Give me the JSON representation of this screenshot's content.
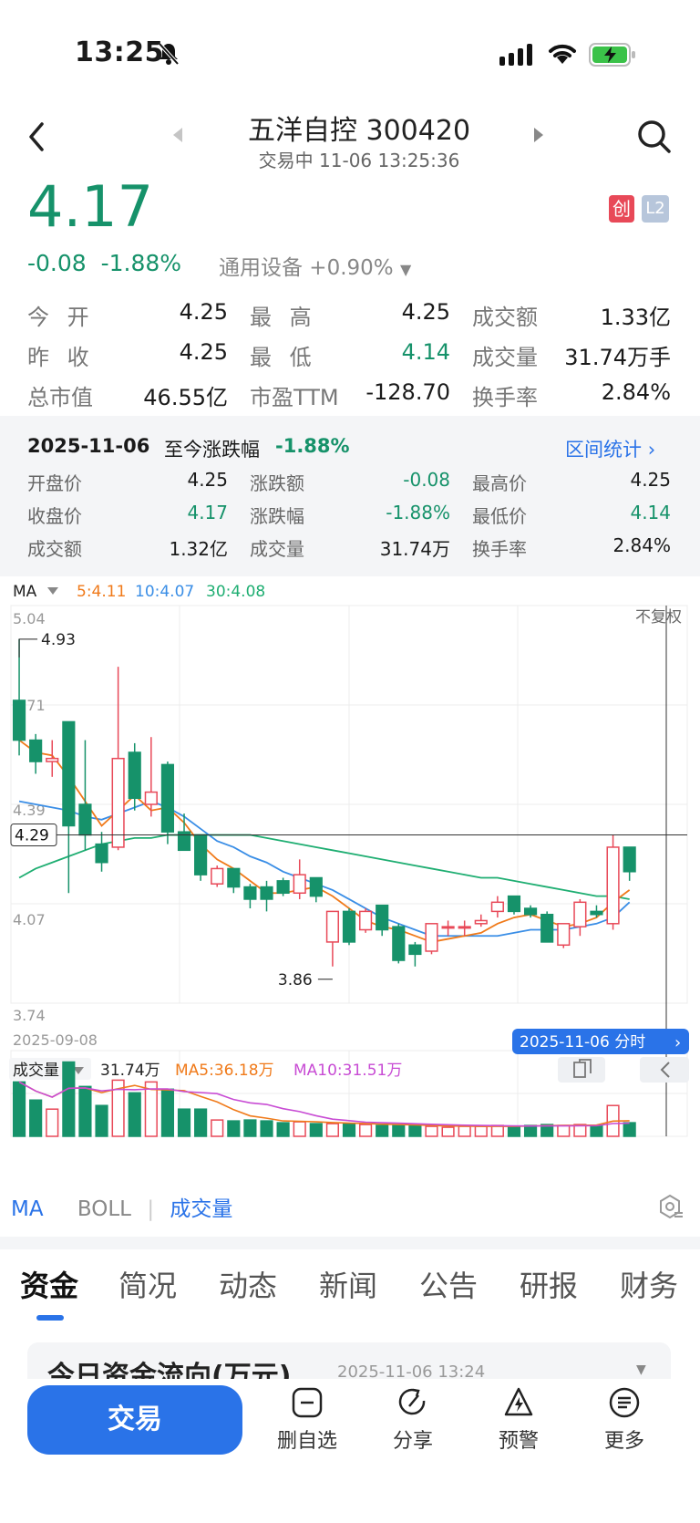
{
  "status": {
    "time": "13:25"
  },
  "header": {
    "title": "五洋自控 300420",
    "subtitle": "交易中 11-06 13:25:36"
  },
  "quote": {
    "price": "4.17",
    "change": "-0.08",
    "change_pct": "-1.88%",
    "sector": "通用设备 +0.90%",
    "badge_chuang": "创",
    "badge_l2": "L2",
    "color_down": "#16926a",
    "color_up": "#e84958"
  },
  "stats": [
    [
      {
        "label": "今 开",
        "value": "4.25"
      },
      {
        "label": "最 高",
        "value": "4.25"
      },
      {
        "label": "成交额",
        "value": "1.33亿"
      }
    ],
    [
      {
        "label": "昨 收",
        "value": "4.25"
      },
      {
        "label": "最 低",
        "value": "4.14"
      },
      {
        "label": "成交量",
        "value": "31.74万手"
      }
    ],
    [
      {
        "label": "总市值",
        "value": "46.55亿"
      },
      {
        "label": "市盈TTM",
        "value": "-128.70"
      },
      {
        "label": "换手率",
        "value": "2.84%"
      }
    ]
  ],
  "history": {
    "date": "2025-11-06",
    "range_label": "至今涨跌幅",
    "range_pct": "-1.88%",
    "link": "区间统计",
    "rows": [
      [
        {
          "label": "开盘价",
          "value": "4.25"
        },
        {
          "label": "涨跌额",
          "value": "-0.08"
        },
        {
          "label": "最高价",
          "value": "4.25"
        }
      ],
      [
        {
          "label": "收盘价",
          "value": "4.17"
        },
        {
          "label": "涨跌幅",
          "value": "-1.88%"
        },
        {
          "label": "最低价",
          "value": "4.14"
        }
      ],
      [
        {
          "label": "成交额",
          "value": "1.32亿"
        },
        {
          "label": "成交量",
          "value": "31.74万"
        },
        {
          "label": "换手率",
          "value": "2.84%"
        }
      ]
    ]
  },
  "kline": {
    "ma_selector": "MA",
    "ma5": "5:4.11",
    "ma10": "10:4.07",
    "ma30": "30:4.08",
    "adjust": "不复权",
    "y_ticks": [
      "5.04",
      "4.71",
      "4.39",
      "4.07",
      "3.74"
    ],
    "high_mark": "4.93",
    "low_mark": "3.86",
    "cross_price": "4.29",
    "start_date": "2025-09-08",
    "cross_date": "2025-11-06 分时",
    "ma_colors": {
      "ma5": "#f07a1a",
      "ma10": "#3a8ee6",
      "ma30": "#1fae72"
    }
  },
  "volume": {
    "selector": "成交量",
    "current": "31.74万",
    "ma5": "MA5:36.18万",
    "ma10": "MA10:31.51万"
  },
  "indicators": {
    "ma": "MA",
    "boll": "BOLL",
    "sep": "|",
    "vol": "成交量"
  },
  "chart_data": {
    "type": "candlestick",
    "ylim": [
      3.74,
      5.04
    ],
    "candles": [
      {
        "o": 4.73,
        "h": 4.93,
        "l": 4.55,
        "c": 4.6
      },
      {
        "o": 4.6,
        "h": 4.62,
        "l": 4.49,
        "c": 4.53
      },
      {
        "o": 4.53,
        "h": 4.6,
        "l": 4.48,
        "c": 4.54
      },
      {
        "o": 4.66,
        "h": 4.66,
        "l": 4.1,
        "c": 4.32
      },
      {
        "o": 4.39,
        "h": 4.6,
        "l": 4.24,
        "c": 4.29
      },
      {
        "o": 4.26,
        "h": 4.3,
        "l": 4.17,
        "c": 4.2
      },
      {
        "o": 4.25,
        "h": 4.84,
        "l": 4.24,
        "c": 4.54
      },
      {
        "o": 4.56,
        "h": 4.59,
        "l": 4.37,
        "c": 4.41
      },
      {
        "o": 4.39,
        "h": 4.61,
        "l": 4.35,
        "c": 4.43
      },
      {
        "o": 4.52,
        "h": 4.53,
        "l": 4.26,
        "c": 4.3
      },
      {
        "o": 4.3,
        "h": 4.36,
        "l": 4.24,
        "c": 4.24
      },
      {
        "o": 4.29,
        "h": 4.29,
        "l": 4.14,
        "c": 4.16
      },
      {
        "o": 4.13,
        "h": 4.19,
        "l": 4.12,
        "c": 4.18
      },
      {
        "o": 4.18,
        "h": 4.18,
        "l": 4.1,
        "c": 4.12
      },
      {
        "o": 4.12,
        "h": 4.13,
        "l": 4.05,
        "c": 4.08
      },
      {
        "o": 4.12,
        "h": 4.14,
        "l": 4.04,
        "c": 4.08
      },
      {
        "o": 4.14,
        "h": 4.15,
        "l": 4.09,
        "c": 4.1
      },
      {
        "o": 4.1,
        "h": 4.21,
        "l": 4.08,
        "c": 4.16
      },
      {
        "o": 4.15,
        "h": 4.15,
        "l": 4.07,
        "c": 4.09
      },
      {
        "o": 3.94,
        "h": 4.04,
        "l": 3.86,
        "c": 4.04
      },
      {
        "o": 4.04,
        "h": 4.05,
        "l": 3.93,
        "c": 3.94
      },
      {
        "o": 3.98,
        "h": 4.05,
        "l": 3.97,
        "c": 4.04
      },
      {
        "o": 4.06,
        "h": 4.06,
        "l": 3.96,
        "c": 3.98
      },
      {
        "o": 3.99,
        "h": 4.0,
        "l": 3.87,
        "c": 3.88
      },
      {
        "o": 3.93,
        "h": 3.94,
        "l": 3.86,
        "c": 3.9
      },
      {
        "o": 3.91,
        "h": 4.0,
        "l": 3.9,
        "c": 4.0
      },
      {
        "o": 3.99,
        "h": 4.01,
        "l": 3.96,
        "c": 3.99
      },
      {
        "o": 3.99,
        "h": 4.01,
        "l": 3.96,
        "c": 3.99
      },
      {
        "o": 4.0,
        "h": 4.03,
        "l": 3.99,
        "c": 4.01
      },
      {
        "o": 4.04,
        "h": 4.09,
        "l": 4.02,
        "c": 4.07
      },
      {
        "o": 4.09,
        "h": 4.09,
        "l": 4.03,
        "c": 4.04
      },
      {
        "o": 4.05,
        "h": 4.06,
        "l": 4.02,
        "c": 4.03
      },
      {
        "o": 4.03,
        "h": 4.04,
        "l": 3.94,
        "c": 3.94
      },
      {
        "o": 3.93,
        "h": 4.0,
        "l": 3.92,
        "c": 4.0
      },
      {
        "o": 3.99,
        "h": 4.08,
        "l": 3.96,
        "c": 4.07
      },
      {
        "o": 4.04,
        "h": 4.06,
        "l": 4.02,
        "c": 4.03
      },
      {
        "o": 4.0,
        "h": 4.29,
        "l": 3.98,
        "c": 4.25
      },
      {
        "o": 4.25,
        "h": 4.25,
        "l": 4.14,
        "c": 4.17
      }
    ],
    "ma5": [
      4.6,
      4.56,
      4.55,
      4.48,
      4.4,
      4.32,
      4.37,
      4.42,
      4.37,
      4.38,
      4.33,
      4.26,
      4.21,
      4.18,
      4.14,
      4.1,
      4.1,
      4.11,
      4.12,
      4.09,
      4.05,
      4.01,
      3.99,
      3.98,
      3.96,
      3.94,
      3.95,
      3.96,
      3.97,
      4.0,
      4.02,
      4.03,
      4.01,
      3.99,
      4.0,
      4.02,
      4.07,
      4.11
    ],
    "ma10": [
      4.4,
      4.39,
      4.38,
      4.37,
      4.35,
      4.34,
      4.36,
      4.38,
      4.4,
      4.38,
      4.35,
      4.31,
      4.27,
      4.25,
      4.22,
      4.2,
      4.17,
      4.15,
      4.13,
      4.11,
      4.08,
      4.05,
      4.02,
      4.0,
      3.98,
      3.96,
      3.96,
      3.96,
      3.96,
      3.96,
      3.97,
      3.98,
      3.98,
      3.98,
      3.99,
      4.0,
      4.02,
      4.07
    ],
    "ma30": [
      4.15,
      4.18,
      4.2,
      4.22,
      4.24,
      4.26,
      4.27,
      4.28,
      4.28,
      4.29,
      4.29,
      4.29,
      4.29,
      4.29,
      4.29,
      4.28,
      4.27,
      4.26,
      4.25,
      4.24,
      4.23,
      4.22,
      4.21,
      4.2,
      4.19,
      4.18,
      4.17,
      4.16,
      4.15,
      4.15,
      4.14,
      4.13,
      4.12,
      4.11,
      4.1,
      4.09,
      4.09,
      4.08
    ],
    "volumes": [
      60,
      40,
      30,
      82,
      55,
      34,
      62,
      48,
      60,
      52,
      30,
      30,
      18,
      17,
      18,
      17,
      15,
      16,
      14,
      14,
      14,
      13,
      12,
      12,
      12,
      11,
      10,
      11,
      11,
      12,
      11,
      12,
      13,
      12,
      13,
      12,
      34,
      15
    ]
  },
  "tabs": [
    "资金",
    "简况",
    "动态",
    "新闻",
    "公告",
    "研报",
    "财务"
  ],
  "fund_card": {
    "title": "今日资金流向(万元)",
    "time": "2025-11-06 13:24"
  },
  "bottom_bar": {
    "trade": "交易",
    "items": [
      "删自选",
      "分享",
      "预警",
      "更多"
    ]
  }
}
